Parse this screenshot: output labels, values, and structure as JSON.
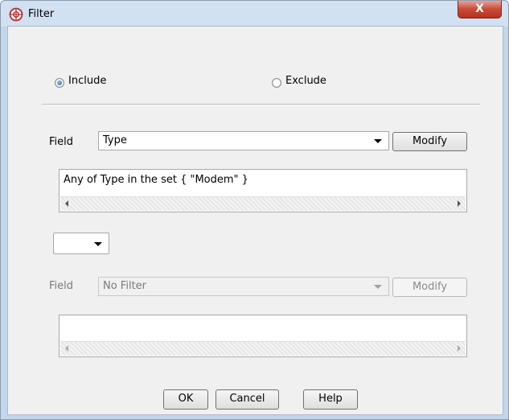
{
  "window": {
    "title": "Filter",
    "close_glyph": "X"
  },
  "mode": {
    "include_label": "Include",
    "exclude_label": "Exclude",
    "selected": "include"
  },
  "filter1": {
    "field_label": "Field",
    "field_value": "Type",
    "modify_label": "Modify",
    "expression": "Any of Type in the set { \"Modem\" }"
  },
  "operator": {
    "value": ""
  },
  "filter2": {
    "field_label": "Field",
    "field_value": "No Filter",
    "modify_label": "Modify",
    "expression": "",
    "enabled": false
  },
  "buttons": {
    "ok": "OK",
    "cancel": "Cancel",
    "help": "Help"
  },
  "icons": {
    "app": "filter-globe-icon",
    "close": "close-icon"
  },
  "colors": {
    "close_button": "#c74a38",
    "app_icon": "#c0282c"
  }
}
